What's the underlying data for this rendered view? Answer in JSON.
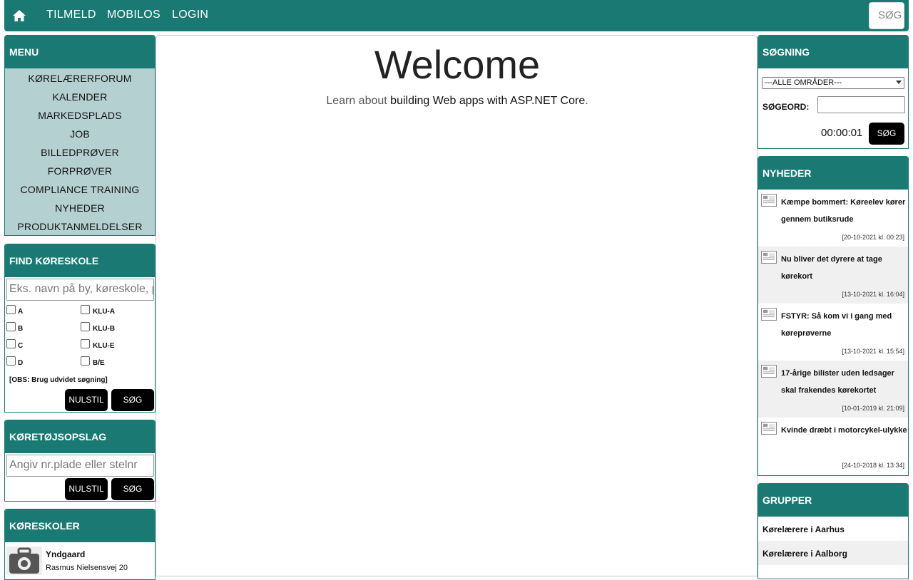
{
  "nav": {
    "home_icon": "home-icon",
    "links": [
      "TILMELD",
      "MOBILOS",
      "LOGIN"
    ],
    "search_placeholder": "SØG"
  },
  "menu": {
    "title": "MENU",
    "items": [
      "KØRELÆRERFORUM",
      "KALENDER",
      "MARKEDSPLADS",
      "JOB",
      "BILLEDPRØVER",
      "FORPRØVER",
      "COMPLIANCE TRAINING",
      "NYHEDER",
      "PRODUKTANMELDELSER"
    ]
  },
  "find": {
    "title": "FIND KØRESKOLE",
    "placeholder": "Eks. navn på by, køreskole, postnr",
    "checkboxes_left": [
      "A",
      "B",
      "C",
      "D"
    ],
    "checkboxes_right": [
      "KLU-A",
      "KLU-B",
      "KLU-E",
      "B/E"
    ],
    "obs": "[OBS: Brug udvidet søgning]",
    "reset_label": "NULSTIL",
    "search_label": "SØG"
  },
  "opslag": {
    "title": "KØRETØJSOPSLAG",
    "placeholder": "Angiv nr.plade eller stelnr",
    "reset_label": "NULSTIL",
    "search_label": "SØG"
  },
  "skoler": {
    "title": "KØRESKOLER",
    "camera_icon": "camera-icon",
    "name": "Yndgaard",
    "address": "Rasmus Nielsensvej 20"
  },
  "main": {
    "heading": "Welcome",
    "learn_prefix": "Learn about ",
    "learn_link": "building Web apps with ASP.NET Core",
    "learn_suffix": "."
  },
  "soegning": {
    "title": "SØGNING",
    "area_selected": "---ALLE OMRÅDER---",
    "keyword_label": "SØGEORD:",
    "timer": "00:00:01",
    "search_label": "SØG"
  },
  "nyheder": {
    "title": "NYHEDER",
    "items": [
      {
        "title": "Kæmpe bommert: Køreelev kører gennem butiksrude",
        "date": "[20-10-2021 kl. 00:23]"
      },
      {
        "title": "Nu bliver det dyrere at tage kørekort",
        "date": "[13-10-2021 kl. 16:04]"
      },
      {
        "title": "FSTYR: Så kom vi i gang med køreprøverne",
        "date": "[13-10-2021 kl. 15:54]"
      },
      {
        "title": "17-årige bilister uden ledsager skal frakendes kørekortet",
        "date": "[10-01-2019 kl. 21:09]"
      },
      {
        "title": "Kvinde dræbt i motorcykel-ulykke",
        "date": "[24-10-2018 kl. 13:34]"
      }
    ]
  },
  "grupper": {
    "title": "GRUPPER",
    "items": [
      "Kørelærere i Aarhus",
      "Kørelærere i Aalborg"
    ]
  },
  "colors": {
    "brand": "#1a7a73",
    "menu_bg": "#b5d0d0",
    "button": "#000000"
  }
}
